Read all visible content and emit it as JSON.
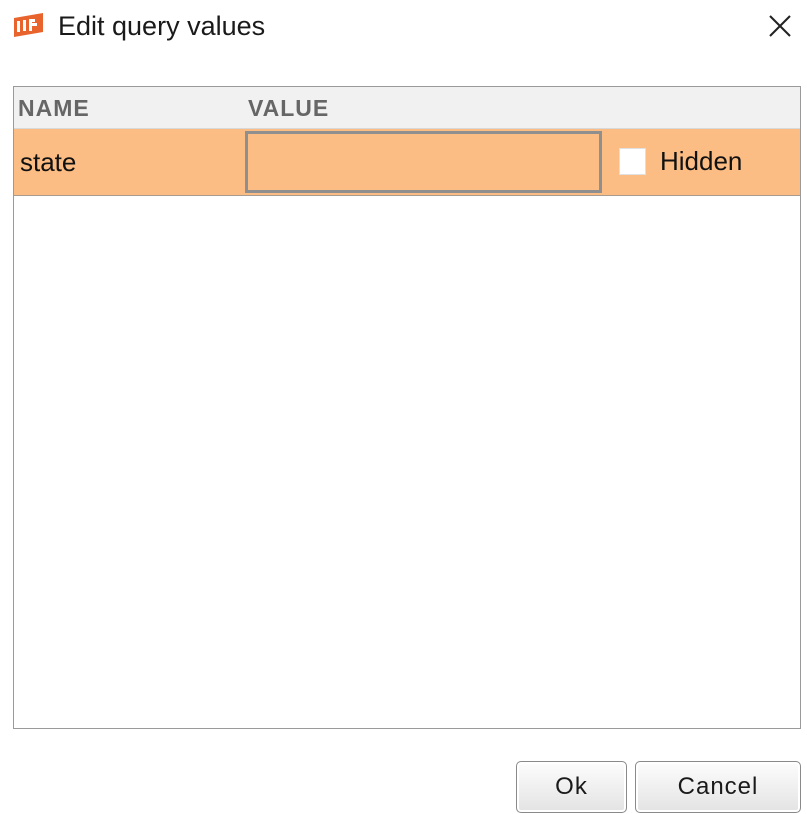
{
  "window": {
    "title": "Edit query values",
    "icon": "app-logo-icon",
    "close_icon": "close-icon",
    "accent_color": "#e8642c"
  },
  "table": {
    "columns": [
      "NAME",
      "VALUE"
    ],
    "rows": [
      {
        "name": "state",
        "value": "",
        "hidden_label": "Hidden",
        "hidden_checked": false,
        "selected": true,
        "row_color": "#fcbd84"
      }
    ]
  },
  "buttons": {
    "ok_label": "Ok",
    "cancel_label": "Cancel"
  }
}
